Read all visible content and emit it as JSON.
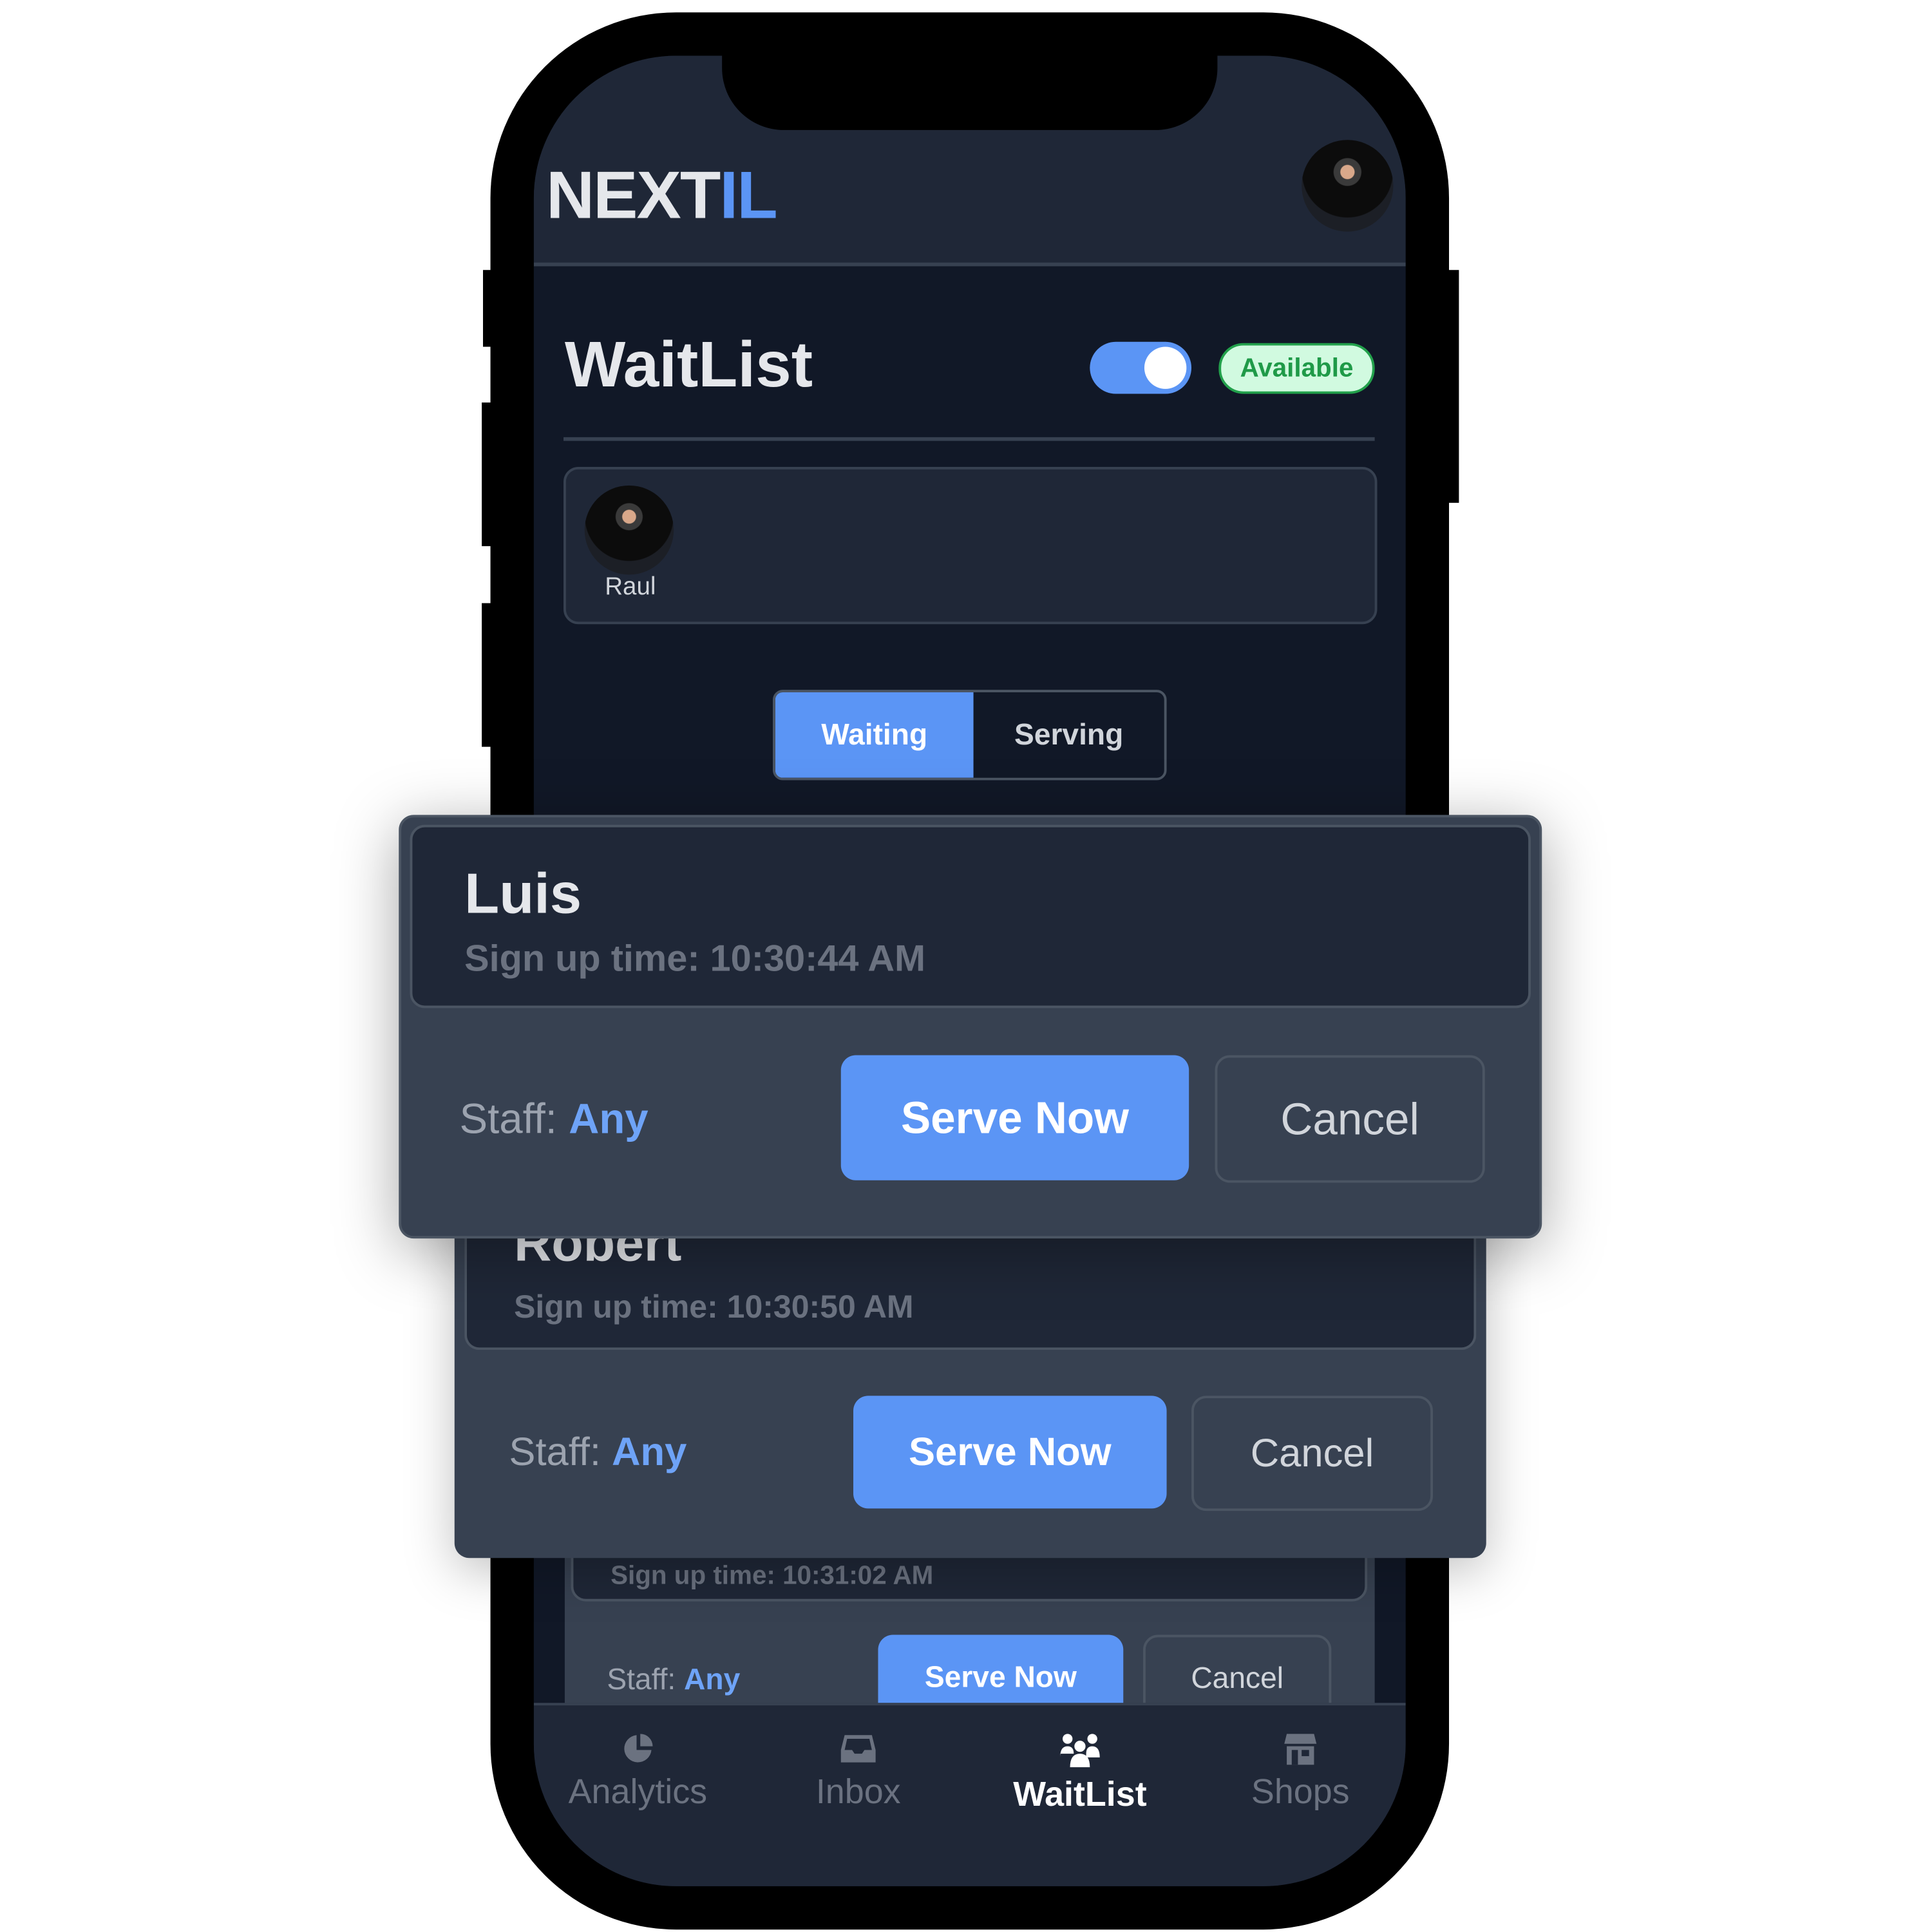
{
  "header": {
    "logo_main": "NEXT",
    "logo_accent": "IL"
  },
  "page": {
    "title": "WaitList",
    "availability_toggle_on": true,
    "status_badge": "Available"
  },
  "staff_list": [
    {
      "name": "Raul"
    }
  ],
  "segmented": {
    "options": [
      "Waiting",
      "Serving"
    ],
    "selected": "Waiting"
  },
  "queue": [
    {
      "name": "Luis",
      "signup": "Sign up time: 10:30:44 AM",
      "staff_label": "Staff:",
      "staff_value": "Any",
      "serve_label": "Serve Now",
      "cancel_label": "Cancel"
    },
    {
      "name": "Robert",
      "signup": "Sign up time: 10:30:50 AM",
      "staff_label": "Staff:",
      "staff_value": "Any",
      "serve_label": "Serve Now",
      "cancel_label": "Cancel"
    },
    {
      "signup": "Sign up time: 10:31:02 AM",
      "staff_label": "Staff:",
      "staff_value": "Any",
      "serve_label": "Serve Now",
      "cancel_label": "Cancel"
    }
  ],
  "nav": {
    "items": [
      {
        "label": "Analytics",
        "icon": "pie-chart-icon"
      },
      {
        "label": "Inbox",
        "icon": "inbox-icon"
      },
      {
        "label": "WaitList",
        "icon": "users-icon",
        "active": true
      },
      {
        "label": "Shops",
        "icon": "store-icon"
      }
    ]
  },
  "colors": {
    "accent": "#5b95f5",
    "available_green": "#1f9a48",
    "background": "#111827",
    "card": "#374151"
  }
}
